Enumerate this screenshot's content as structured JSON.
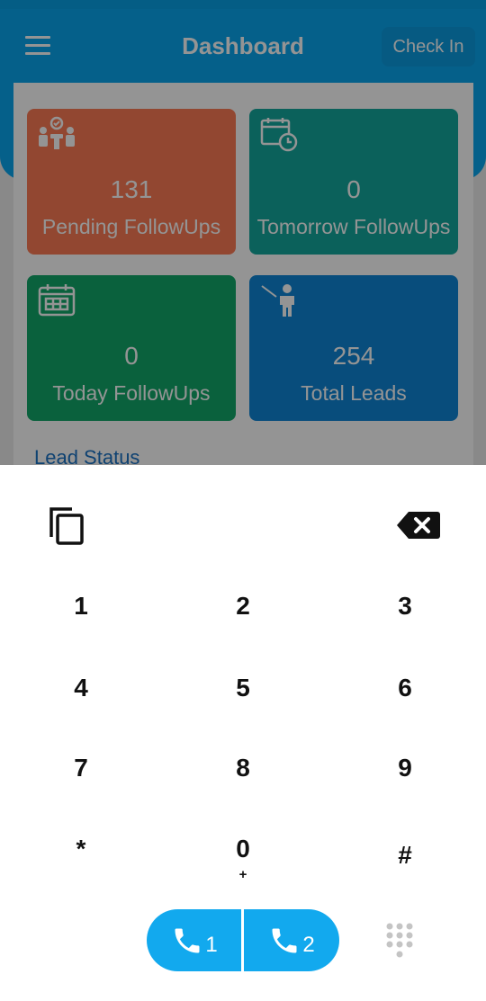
{
  "header": {
    "title": "Dashboard",
    "checkin_label": "Check In"
  },
  "cards": [
    {
      "value": "131",
      "label": "Pending FollowUps",
      "color": "#fb7a55",
      "icon": "team-meeting-icon"
    },
    {
      "value": "0",
      "label": "Tomorrow FollowUps",
      "color": "#13a89e",
      "icon": "calendar-clock-icon"
    },
    {
      "value": "0",
      "label": "Today FollowUps",
      "color": "#12a86a",
      "icon": "calendar-icon"
    },
    {
      "value": "254",
      "label": "Total Leads",
      "color": "#0e86d6",
      "icon": "presenter-icon"
    }
  ],
  "section": {
    "title": "Lead Status"
  },
  "dialer": {
    "keys": [
      {
        "digit": "1"
      },
      {
        "digit": "2"
      },
      {
        "digit": "3"
      },
      {
        "digit": "4"
      },
      {
        "digit": "5"
      },
      {
        "digit": "6"
      },
      {
        "digit": "7"
      },
      {
        "digit": "8"
      },
      {
        "digit": "9"
      },
      {
        "digit": "*"
      },
      {
        "digit": "0",
        "sub": "+"
      },
      {
        "digit": "#"
      }
    ],
    "call_sim1": "1",
    "call_sim2": "2",
    "accent": "#12a9ee"
  }
}
